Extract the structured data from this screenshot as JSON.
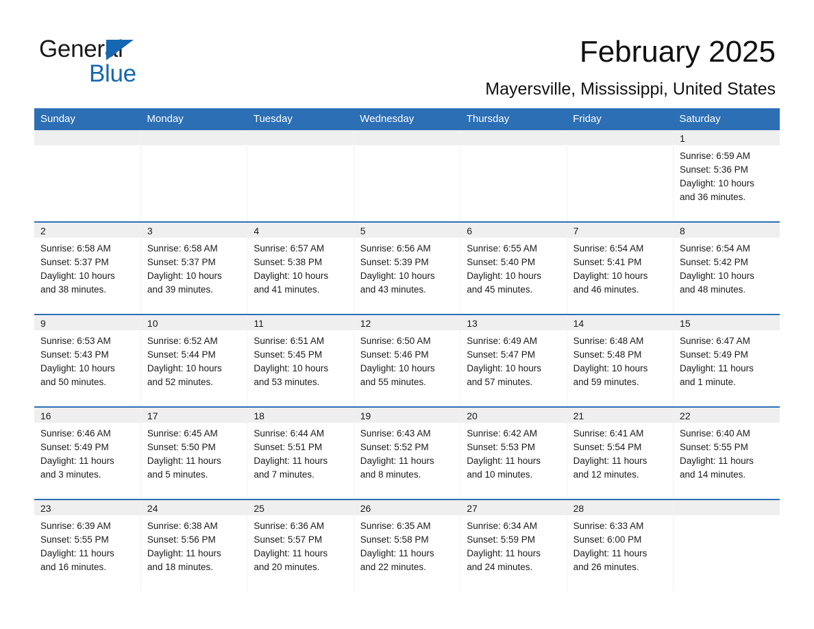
{
  "brand": {
    "name_line1": "General",
    "name_line2": "Blue",
    "accent_color": "#1567b3"
  },
  "header": {
    "title": "February 2025",
    "subtitle": "Mayersville, Mississippi, United States"
  },
  "theme": {
    "header_blue": "#2c6fb5",
    "daynum_bg": "#efefef",
    "cell_bg": "#ffffff",
    "text": "#1a1a1a"
  },
  "calendar": {
    "weekday_headers": [
      "Sunday",
      "Monday",
      "Tuesday",
      "Wednesday",
      "Thursday",
      "Friday",
      "Saturday"
    ],
    "weeks": [
      [
        {
          "day": "",
          "blank": true,
          "sunrise": "",
          "sunset": "",
          "daylight_l1": "",
          "daylight_l2": ""
        },
        {
          "day": "",
          "blank": true,
          "sunrise": "",
          "sunset": "",
          "daylight_l1": "",
          "daylight_l2": ""
        },
        {
          "day": "",
          "blank": true,
          "sunrise": "",
          "sunset": "",
          "daylight_l1": "",
          "daylight_l2": ""
        },
        {
          "day": "",
          "blank": true,
          "sunrise": "",
          "sunset": "",
          "daylight_l1": "",
          "daylight_l2": ""
        },
        {
          "day": "",
          "blank": true,
          "sunrise": "",
          "sunset": "",
          "daylight_l1": "",
          "daylight_l2": ""
        },
        {
          "day": "",
          "blank": true,
          "sunrise": "",
          "sunset": "",
          "daylight_l1": "",
          "daylight_l2": ""
        },
        {
          "day": "1",
          "blank": false,
          "sunrise": "Sunrise: 6:59 AM",
          "sunset": "Sunset: 5:36 PM",
          "daylight_l1": "Daylight: 10 hours",
          "daylight_l2": "and 36 minutes."
        }
      ],
      [
        {
          "day": "2",
          "blank": false,
          "sunrise": "Sunrise: 6:58 AM",
          "sunset": "Sunset: 5:37 PM",
          "daylight_l1": "Daylight: 10 hours",
          "daylight_l2": "and 38 minutes."
        },
        {
          "day": "3",
          "blank": false,
          "sunrise": "Sunrise: 6:58 AM",
          "sunset": "Sunset: 5:37 PM",
          "daylight_l1": "Daylight: 10 hours",
          "daylight_l2": "and 39 minutes."
        },
        {
          "day": "4",
          "blank": false,
          "sunrise": "Sunrise: 6:57 AM",
          "sunset": "Sunset: 5:38 PM",
          "daylight_l1": "Daylight: 10 hours",
          "daylight_l2": "and 41 minutes."
        },
        {
          "day": "5",
          "blank": false,
          "sunrise": "Sunrise: 6:56 AM",
          "sunset": "Sunset: 5:39 PM",
          "daylight_l1": "Daylight: 10 hours",
          "daylight_l2": "and 43 minutes."
        },
        {
          "day": "6",
          "blank": false,
          "sunrise": "Sunrise: 6:55 AM",
          "sunset": "Sunset: 5:40 PM",
          "daylight_l1": "Daylight: 10 hours",
          "daylight_l2": "and 45 minutes."
        },
        {
          "day": "7",
          "blank": false,
          "sunrise": "Sunrise: 6:54 AM",
          "sunset": "Sunset: 5:41 PM",
          "daylight_l1": "Daylight: 10 hours",
          "daylight_l2": "and 46 minutes."
        },
        {
          "day": "8",
          "blank": false,
          "sunrise": "Sunrise: 6:54 AM",
          "sunset": "Sunset: 5:42 PM",
          "daylight_l1": "Daylight: 10 hours",
          "daylight_l2": "and 48 minutes."
        }
      ],
      [
        {
          "day": "9",
          "blank": false,
          "sunrise": "Sunrise: 6:53 AM",
          "sunset": "Sunset: 5:43 PM",
          "daylight_l1": "Daylight: 10 hours",
          "daylight_l2": "and 50 minutes."
        },
        {
          "day": "10",
          "blank": false,
          "sunrise": "Sunrise: 6:52 AM",
          "sunset": "Sunset: 5:44 PM",
          "daylight_l1": "Daylight: 10 hours",
          "daylight_l2": "and 52 minutes."
        },
        {
          "day": "11",
          "blank": false,
          "sunrise": "Sunrise: 6:51 AM",
          "sunset": "Sunset: 5:45 PM",
          "daylight_l1": "Daylight: 10 hours",
          "daylight_l2": "and 53 minutes."
        },
        {
          "day": "12",
          "blank": false,
          "sunrise": "Sunrise: 6:50 AM",
          "sunset": "Sunset: 5:46 PM",
          "daylight_l1": "Daylight: 10 hours",
          "daylight_l2": "and 55 minutes."
        },
        {
          "day": "13",
          "blank": false,
          "sunrise": "Sunrise: 6:49 AM",
          "sunset": "Sunset: 5:47 PM",
          "daylight_l1": "Daylight: 10 hours",
          "daylight_l2": "and 57 minutes."
        },
        {
          "day": "14",
          "blank": false,
          "sunrise": "Sunrise: 6:48 AM",
          "sunset": "Sunset: 5:48 PM",
          "daylight_l1": "Daylight: 10 hours",
          "daylight_l2": "and 59 minutes."
        },
        {
          "day": "15",
          "blank": false,
          "sunrise": "Sunrise: 6:47 AM",
          "sunset": "Sunset: 5:49 PM",
          "daylight_l1": "Daylight: 11 hours",
          "daylight_l2": "and 1 minute."
        }
      ],
      [
        {
          "day": "16",
          "blank": false,
          "sunrise": "Sunrise: 6:46 AM",
          "sunset": "Sunset: 5:49 PM",
          "daylight_l1": "Daylight: 11 hours",
          "daylight_l2": "and 3 minutes."
        },
        {
          "day": "17",
          "blank": false,
          "sunrise": "Sunrise: 6:45 AM",
          "sunset": "Sunset: 5:50 PM",
          "daylight_l1": "Daylight: 11 hours",
          "daylight_l2": "and 5 minutes."
        },
        {
          "day": "18",
          "blank": false,
          "sunrise": "Sunrise: 6:44 AM",
          "sunset": "Sunset: 5:51 PM",
          "daylight_l1": "Daylight: 11 hours",
          "daylight_l2": "and 7 minutes."
        },
        {
          "day": "19",
          "blank": false,
          "sunrise": "Sunrise: 6:43 AM",
          "sunset": "Sunset: 5:52 PM",
          "daylight_l1": "Daylight: 11 hours",
          "daylight_l2": "and 8 minutes."
        },
        {
          "day": "20",
          "blank": false,
          "sunrise": "Sunrise: 6:42 AM",
          "sunset": "Sunset: 5:53 PM",
          "daylight_l1": "Daylight: 11 hours",
          "daylight_l2": "and 10 minutes."
        },
        {
          "day": "21",
          "blank": false,
          "sunrise": "Sunrise: 6:41 AM",
          "sunset": "Sunset: 5:54 PM",
          "daylight_l1": "Daylight: 11 hours",
          "daylight_l2": "and 12 minutes."
        },
        {
          "day": "22",
          "blank": false,
          "sunrise": "Sunrise: 6:40 AM",
          "sunset": "Sunset: 5:55 PM",
          "daylight_l1": "Daylight: 11 hours",
          "daylight_l2": "and 14 minutes."
        }
      ],
      [
        {
          "day": "23",
          "blank": false,
          "sunrise": "Sunrise: 6:39 AM",
          "sunset": "Sunset: 5:55 PM",
          "daylight_l1": "Daylight: 11 hours",
          "daylight_l2": "and 16 minutes."
        },
        {
          "day": "24",
          "blank": false,
          "sunrise": "Sunrise: 6:38 AM",
          "sunset": "Sunset: 5:56 PM",
          "daylight_l1": "Daylight: 11 hours",
          "daylight_l2": "and 18 minutes."
        },
        {
          "day": "25",
          "blank": false,
          "sunrise": "Sunrise: 6:36 AM",
          "sunset": "Sunset: 5:57 PM",
          "daylight_l1": "Daylight: 11 hours",
          "daylight_l2": "and 20 minutes."
        },
        {
          "day": "26",
          "blank": false,
          "sunrise": "Sunrise: 6:35 AM",
          "sunset": "Sunset: 5:58 PM",
          "daylight_l1": "Daylight: 11 hours",
          "daylight_l2": "and 22 minutes."
        },
        {
          "day": "27",
          "blank": false,
          "sunrise": "Sunrise: 6:34 AM",
          "sunset": "Sunset: 5:59 PM",
          "daylight_l1": "Daylight: 11 hours",
          "daylight_l2": "and 24 minutes."
        },
        {
          "day": "28",
          "blank": false,
          "sunrise": "Sunrise: 6:33 AM",
          "sunset": "Sunset: 6:00 PM",
          "daylight_l1": "Daylight: 11 hours",
          "daylight_l2": "and 26 minutes."
        },
        {
          "day": "",
          "blank": true,
          "sunrise": "",
          "sunset": "",
          "daylight_l1": "",
          "daylight_l2": ""
        }
      ]
    ]
  }
}
